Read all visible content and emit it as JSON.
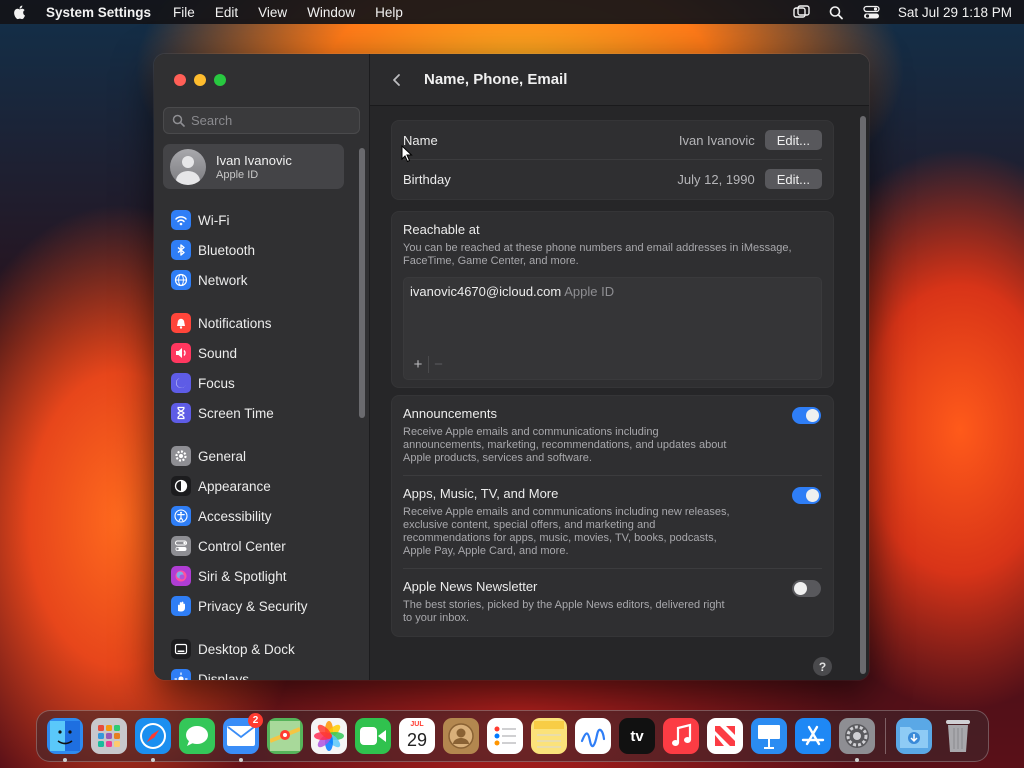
{
  "menubar": {
    "app_name": "System Settings",
    "items": [
      "File",
      "Edit",
      "View",
      "Window",
      "Help"
    ],
    "datetime": "Sat Jul 29  1:18 PM"
  },
  "sidebar": {
    "search_placeholder": "Search",
    "account": {
      "name": "Ivan Ivanovic",
      "subtitle": "Apple ID"
    },
    "groups": [
      [
        {
          "label": "Wi-Fi",
          "icon": "wifi-icon",
          "color": "#2f7ef6"
        },
        {
          "label": "Bluetooth",
          "icon": "bluetooth-icon",
          "color": "#2f7ef6"
        },
        {
          "label": "Network",
          "icon": "globe-icon",
          "color": "#2f7ef6"
        }
      ],
      [
        {
          "label": "Notifications",
          "icon": "bell-icon",
          "color": "#ff453a"
        },
        {
          "label": "Sound",
          "icon": "speaker-icon",
          "color": "#ff375f"
        },
        {
          "label": "Focus",
          "icon": "moon-icon",
          "color": "#5e5ce6"
        },
        {
          "label": "Screen Time",
          "icon": "hourglass-icon",
          "color": "#5e5ce6"
        }
      ],
      [
        {
          "label": "General",
          "icon": "gear-icon",
          "color": "#8e8e93"
        },
        {
          "label": "Appearance",
          "icon": "appearance-icon",
          "color": "#1c1c1e"
        },
        {
          "label": "Accessibility",
          "icon": "accessibility-icon",
          "color": "#2f7ef6"
        },
        {
          "label": "Control Center",
          "icon": "control-center-icon",
          "color": "#8e8e93"
        },
        {
          "label": "Siri & Spotlight",
          "icon": "siri-icon",
          "color": "#b03dd4"
        },
        {
          "label": "Privacy & Security",
          "icon": "hand-icon",
          "color": "#2f7ef6"
        }
      ],
      [
        {
          "label": "Desktop & Dock",
          "icon": "dock-icon",
          "color": "#1c1c1e"
        },
        {
          "label": "Displays",
          "icon": "sun-icon",
          "color": "#2f7ef6"
        }
      ]
    ]
  },
  "page": {
    "title": "Name, Phone, Email",
    "name": {
      "label": "Name",
      "value": "Ivan Ivanovic",
      "button": "Edit..."
    },
    "birthday": {
      "label": "Birthday",
      "value": "July 12, 1990",
      "button": "Edit..."
    },
    "reachable": {
      "title": "Reachable at",
      "description": "You can be reached at these phone numbers and email addresses in iMessage, FaceTime, Game Center, and more.",
      "email": "ivanovic4670@icloud.com",
      "email_tag": "Apple ID",
      "add": "+",
      "remove": "−"
    },
    "options": [
      {
        "title": "Announcements",
        "description": "Receive Apple emails and communications including announcements, marketing, recommendations, and updates about Apple products, services and software.",
        "on": true
      },
      {
        "title": "Apps, Music, TV, and More",
        "description": "Receive Apple emails and communications including new releases, exclusive content, special offers, and marketing and recommendations for apps, music, movies, TV, books, podcasts, Apple Pay, Apple Card, and more.",
        "on": true
      },
      {
        "title": "Apple News Newsletter",
        "description": "The best stories, picked by the Apple News editors, delivered right to your inbox.",
        "on": false
      }
    ],
    "help": "?"
  },
  "dock": {
    "mail_badge": "2",
    "calendar_month": "JUL",
    "calendar_day": "29",
    "tv_label": "tv",
    "apps": [
      {
        "name": "finder",
        "color": "#2e8bf0",
        "running": true
      },
      {
        "name": "launchpad",
        "color": "#c8c8cc",
        "running": false
      },
      {
        "name": "safari",
        "color": "#1b8ff0",
        "running": true
      },
      {
        "name": "messages",
        "color": "#34c759",
        "running": false
      },
      {
        "name": "mail",
        "color": "#3a8df7",
        "running": true
      },
      {
        "name": "maps",
        "color": "#56b45a",
        "running": false
      },
      {
        "name": "photos",
        "color": "#f5f5f5",
        "running": false
      },
      {
        "name": "facetime",
        "color": "#30c24e",
        "running": false
      },
      {
        "name": "calendar",
        "color": "#ffffff",
        "running": false
      },
      {
        "name": "contacts",
        "color": "#b3874f",
        "running": false
      },
      {
        "name": "reminders",
        "color": "#ffffff",
        "running": false
      },
      {
        "name": "notes",
        "color": "#fbe27a",
        "running": false
      },
      {
        "name": "freeform",
        "color": "#ffffff",
        "running": false
      },
      {
        "name": "apple-tv",
        "color": "#111111",
        "running": false
      },
      {
        "name": "music",
        "color": "#fc3c44",
        "running": false
      },
      {
        "name": "news",
        "color": "#ffffff",
        "running": false
      },
      {
        "name": "keynote",
        "color": "#2b8cf2",
        "running": false
      },
      {
        "name": "app-store",
        "color": "#1e88f5",
        "running": false
      },
      {
        "name": "system-settings",
        "color": "#8e8e93",
        "running": true
      }
    ]
  }
}
